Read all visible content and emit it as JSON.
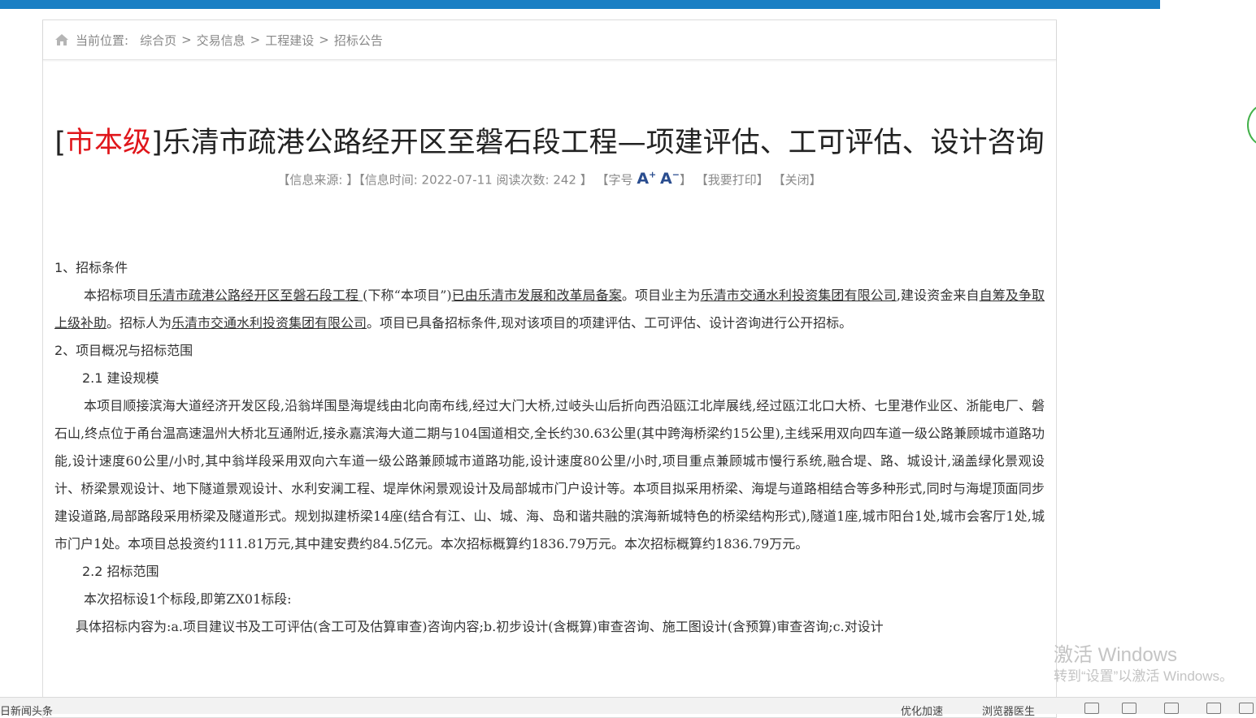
{
  "breadcrumb": {
    "label": "当前位置:",
    "items": [
      "综合页",
      "交易信息",
      "工程建设",
      "招标公告"
    ],
    "separator": ">"
  },
  "article": {
    "level": "市本级",
    "title": "乐清市疏港公路经开区至磐石段工程—项建评估、工可评估、设计咨询",
    "meta": {
      "source_label": "【信息来源: 】",
      "time_label": "【信息时间: 2022-07-11 阅读次数: ",
      "views": "242",
      "close_bracket": "】",
      "font_label": "【字号",
      "font_up": "A",
      "font_down": "A",
      "font_end": "】",
      "print": "【我要打印】",
      "close": "【关闭】"
    }
  },
  "content": {
    "s1_heading": "1、招标条件",
    "s1_p1_a": "本招标项目",
    "s1_p1_project": "乐清市疏港公路经开区至磐石段工程 ",
    "s1_p1_b": "(下称“本项目”)",
    "s1_p1_approval": "已由乐清市发展和改革局备案",
    "s1_p1_c": "。项目业主为",
    "s1_p1_owner": "乐清市交通水利投资集团有限公司",
    "s1_p1_d": ",建设资金来自",
    "s1_p1_funds": "自筹及争取上级补助",
    "s1_p1_e": "。招标人为",
    "s1_p1_tenderer": "乐清市交通水利投资集团有限公司",
    "s1_p1_f": "。项目已具备招标条件,现对该项目的项建评估、工可评估、设计咨询进行公开招标。",
    "s2_heading": "2、项目概况与招标范围",
    "s21_heading": "2.1 建设规模",
    "s21_p": "本项目顺接滨海大道经济开发区段,沿翁垟围垦海堤线由北向南布线,经过大门大桥,过岐头山后折向西沿瓯江北岸展线,经过瓯江北口大桥、七里港作业区、浙能电厂、磐石山,终点位于甬台温高速温州大桥北互通附近,接永嘉滨海大道二期与104国道相交,全长约30.63公里(其中跨海桥梁约15公里),主线采用双向四车道一级公路兼顾城市道路功能,设计速度60公里/小时,其中翁垟段采用双向六车道一级公路兼顾城市道路功能,设计速度80公里/小时,项目重点兼顾城市慢行系统,融合堤、路、城设计,涵盖绿化景观设计、桥梁景观设计、地下隧道景观设计、水利安澜工程、堤岸休闲景观设计及局部城市门户设计等。本项目拟采用桥梁、海堤与道路相结合等多种形式,同时与海堤顶面同步建设道路,局部路段采用桥梁及隧道形式。规划拟建桥梁14座(结合有江、山、城、海、岛和谐共融的滨海新城特色的桥梁结构形式),隧道1座,城市阳台1处,城市会客厅1处,城市门户1处。本项目总投资约111.81万元,其中建安费约84.5亿元。本次招标概算约1836.79万元。本次招标概算约1836.79万元。",
    "s22_heading": "2.2 招标范围",
    "s22_p1": "本次招标设1个标段,即第ZX01标段:",
    "s22_p2": "具体招标内容为:a.项目建议书及工可评估(含工可及估算审查)咨询内容;b.初步设计(含概算)审查咨询、施工图设计(含预算)审查咨询;c.对设计"
  },
  "watermark": {
    "line1": "激活 Windows",
    "line2": "转到“设置”以激活 Windows。"
  },
  "statusbar": {
    "left": "日新闻头条",
    "optimize": "优化加速",
    "browser_doctor": "浏览器医生"
  },
  "colors": {
    "topbar": "#1a7fc4",
    "level_red": "#e0161b",
    "font_size_blue": "#2a4d8f"
  }
}
